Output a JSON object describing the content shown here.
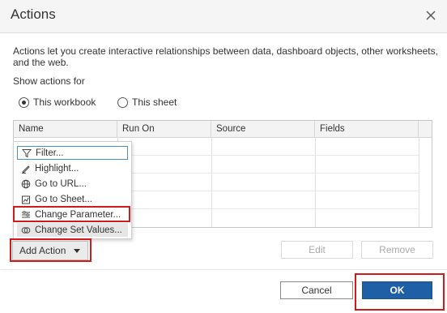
{
  "dialog": {
    "title": "Actions",
    "description": "Actions let you create interactive relationships between data, dashboard objects, other worksheets, and the web.",
    "show_actions_label": "Show actions for",
    "scope_options": [
      {
        "label": "This workbook",
        "selected": true
      },
      {
        "label": "This sheet",
        "selected": false
      }
    ]
  },
  "table": {
    "columns": [
      "Name",
      "Run On",
      "Source",
      "Fields"
    ],
    "rows": []
  },
  "add_action_menu": {
    "items": [
      {
        "label": "Filter...",
        "icon": "filter-icon"
      },
      {
        "label": "Highlight...",
        "icon": "highlight-icon"
      },
      {
        "label": "Go to URL...",
        "icon": "globe-icon"
      },
      {
        "label": "Go to Sheet...",
        "icon": "sheet-icon"
      },
      {
        "label": "Change Parameter...",
        "icon": "parameter-icon"
      },
      {
        "label": "Change Set Values...",
        "icon": "set-icon"
      }
    ]
  },
  "buttons": {
    "add_action": "Add Action",
    "edit": "Edit",
    "remove": "Remove",
    "cancel": "Cancel",
    "ok": "OK"
  },
  "colors": {
    "primary": "#1f5fa6",
    "highlight_box": "#d11a1a"
  }
}
